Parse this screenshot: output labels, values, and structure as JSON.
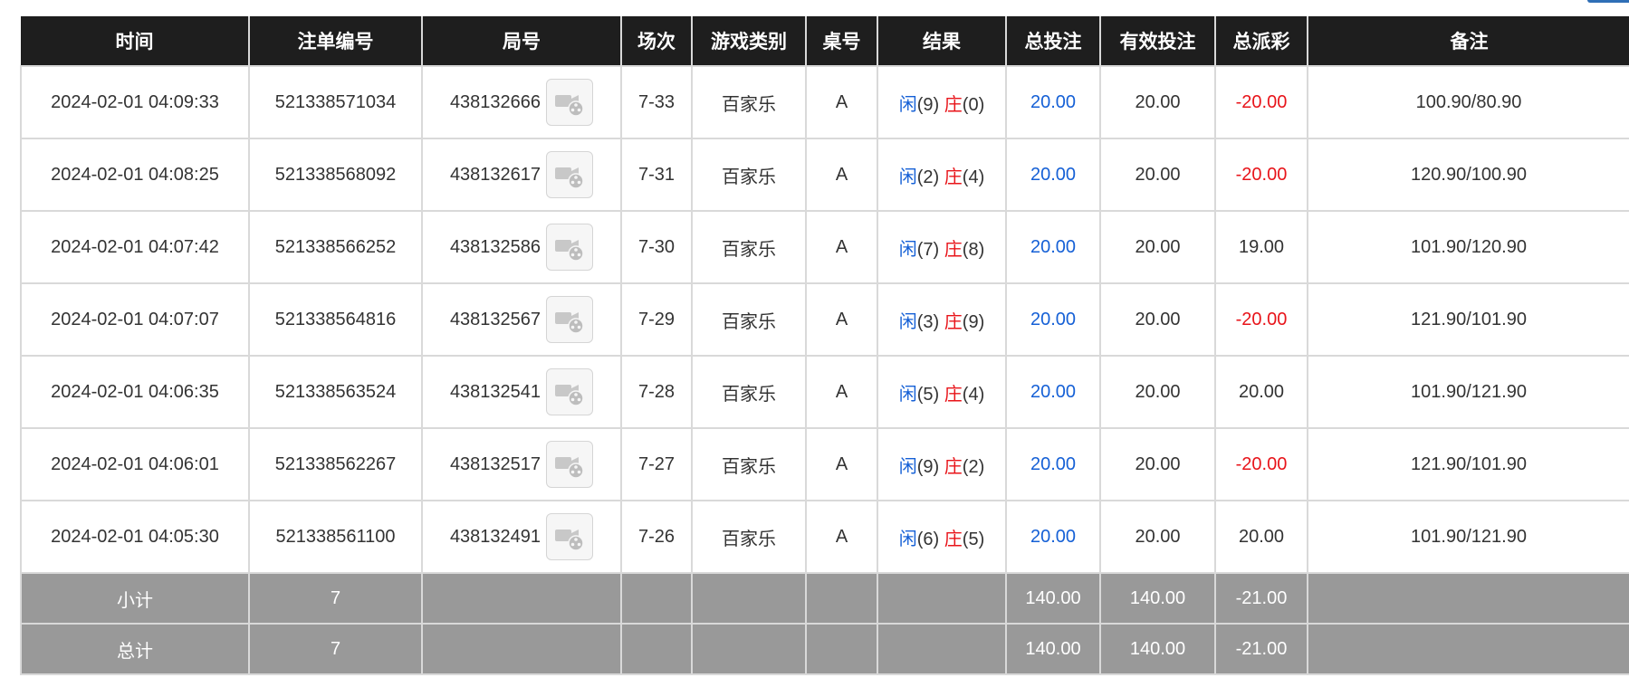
{
  "headers": [
    "时间",
    "注单编号",
    "局号",
    "场次",
    "游戏类别",
    "桌号",
    "结果",
    "总投注",
    "有效投注",
    "总派彩",
    "备注"
  ],
  "result_labels": {
    "player": "闲",
    "banker": "庄"
  },
  "colors": {
    "header_bg": "#1e1e1e",
    "total_bet": "#1560d6",
    "negative": "#e8141a",
    "summary_bg": "#999999"
  },
  "icons": {
    "round_video": "video-replay-icon"
  },
  "rows": [
    {
      "time": "2024-02-01 04:09:33",
      "order_no": "521338571034",
      "round_no": "438132666",
      "session": "7-33",
      "game_type": "百家乐",
      "table": "A",
      "player_points": "(9)",
      "banker_points": "(0)",
      "total_bet": "20.00",
      "valid_bet": "20.00",
      "payout": "-20.00",
      "payout_negative": true,
      "remark": "100.90/80.90"
    },
    {
      "time": "2024-02-01 04:08:25",
      "order_no": "521338568092",
      "round_no": "438132617",
      "session": "7-31",
      "game_type": "百家乐",
      "table": "A",
      "player_points": "(2)",
      "banker_points": "(4)",
      "total_bet": "20.00",
      "valid_bet": "20.00",
      "payout": "-20.00",
      "payout_negative": true,
      "remark": "120.90/100.90"
    },
    {
      "time": "2024-02-01 04:07:42",
      "order_no": "521338566252",
      "round_no": "438132586",
      "session": "7-30",
      "game_type": "百家乐",
      "table": "A",
      "player_points": "(7)",
      "banker_points": "(8)",
      "total_bet": "20.00",
      "valid_bet": "20.00",
      "payout": "19.00",
      "payout_negative": false,
      "remark": "101.90/120.90"
    },
    {
      "time": "2024-02-01 04:07:07",
      "order_no": "521338564816",
      "round_no": "438132567",
      "session": "7-29",
      "game_type": "百家乐",
      "table": "A",
      "player_points": "(3)",
      "banker_points": "(9)",
      "total_bet": "20.00",
      "valid_bet": "20.00",
      "payout": "-20.00",
      "payout_negative": true,
      "remark": "121.90/101.90"
    },
    {
      "time": "2024-02-01 04:06:35",
      "order_no": "521338563524",
      "round_no": "438132541",
      "session": "7-28",
      "game_type": "百家乐",
      "table": "A",
      "player_points": "(5)",
      "banker_points": "(4)",
      "total_bet": "20.00",
      "valid_bet": "20.00",
      "payout": "20.00",
      "payout_negative": false,
      "remark": "101.90/121.90"
    },
    {
      "time": "2024-02-01 04:06:01",
      "order_no": "521338562267",
      "round_no": "438132517",
      "session": "7-27",
      "game_type": "百家乐",
      "table": "A",
      "player_points": "(9)",
      "banker_points": "(2)",
      "total_bet": "20.00",
      "valid_bet": "20.00",
      "payout": "-20.00",
      "payout_negative": true,
      "remark": "121.90/101.90"
    },
    {
      "time": "2024-02-01 04:05:30",
      "order_no": "521338561100",
      "round_no": "438132491",
      "session": "7-26",
      "game_type": "百家乐",
      "table": "A",
      "player_points": "(6)",
      "banker_points": "(5)",
      "total_bet": "20.00",
      "valid_bet": "20.00",
      "payout": "20.00",
      "payout_negative": false,
      "remark": "101.90/121.90"
    }
  ],
  "subtotal": {
    "label": "小计",
    "count": "7",
    "total_bet": "140.00",
    "valid_bet": "140.00",
    "payout": "-21.00"
  },
  "grandtotal": {
    "label": "总计",
    "count": "7",
    "total_bet": "140.00",
    "valid_bet": "140.00",
    "payout": "-21.00"
  }
}
